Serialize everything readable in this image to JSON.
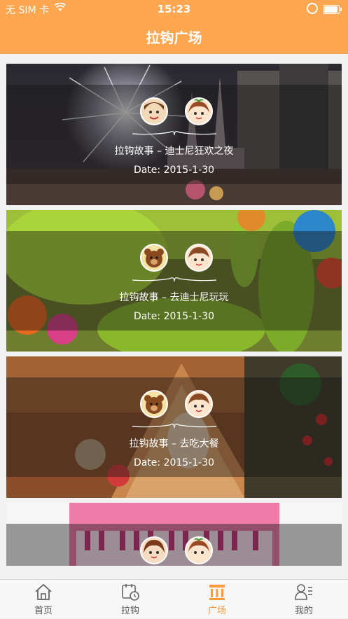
{
  "status_bar": {
    "carrier": "无 SIM 卡",
    "time": "15:23"
  },
  "header": {
    "title": "拉钩广场"
  },
  "cards": [
    {
      "title": "拉钩故事 – 迪士尼狂欢之夜",
      "date": "Date: 2015-1-30",
      "theme": "castle-night"
    },
    {
      "title": "拉钩故事 – 去迪士尼玩玩",
      "date": "Date: 2015-1-30",
      "theme": "balloon-dog"
    },
    {
      "title": "拉钩故事 – 去吃大餐",
      "date": "Date: 2015-1-30",
      "theme": "gingerbread"
    },
    {
      "title": "",
      "date": "",
      "theme": "pink-piano"
    }
  ],
  "tabbar": {
    "items": [
      {
        "label": "首页",
        "icon": "home-icon"
      },
      {
        "label": "拉钩",
        "icon": "calendar-clock-icon"
      },
      {
        "label": "广场",
        "icon": "plaza-icon",
        "active": true
      },
      {
        "label": "我的",
        "icon": "profile-list-icon"
      }
    ],
    "accent": "#ffa651"
  }
}
